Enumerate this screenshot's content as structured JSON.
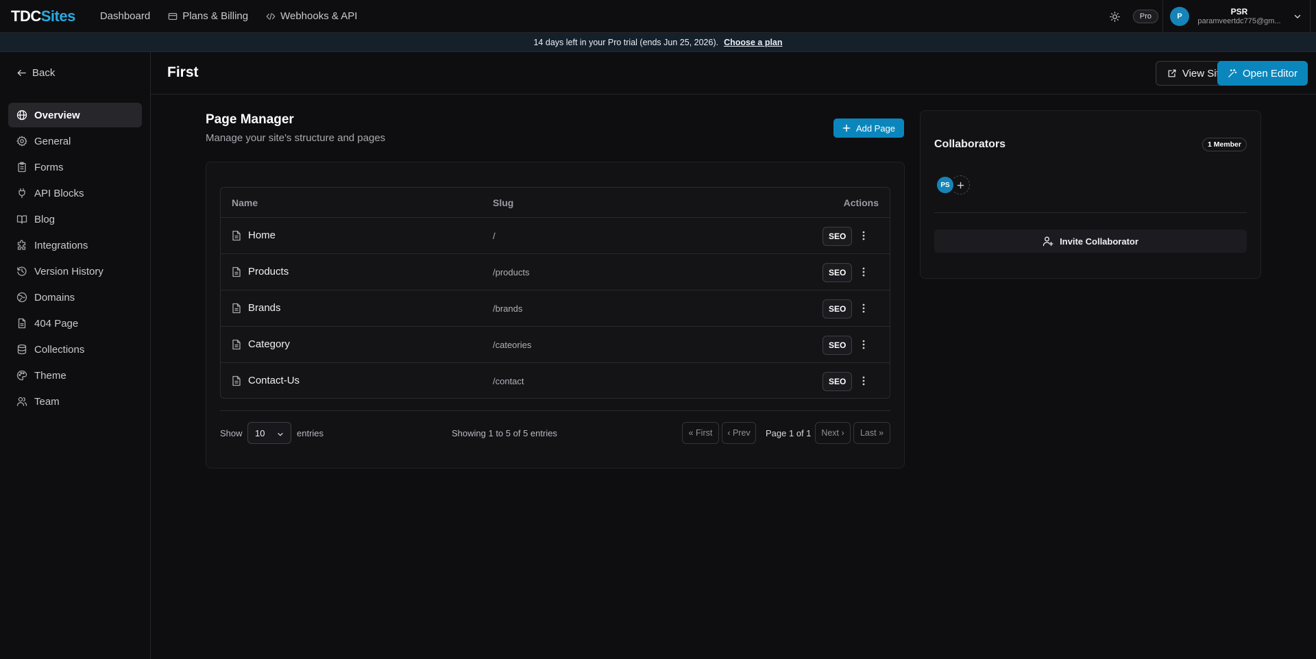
{
  "brand": {
    "part1": "TDC",
    "part2": "Sites"
  },
  "nav": {
    "dashboard": "Dashboard",
    "billing": "Plans & Billing",
    "webhooks": "Webhooks & API"
  },
  "user": {
    "plan_badge": "Pro",
    "avatar_initial": "P",
    "name": "PSR",
    "email": "paramveertdc775@gm..."
  },
  "banner": {
    "text": "14 days left in your Pro trial (ends Jun 25, 2026).",
    "cta": "Choose a plan"
  },
  "sidebar": {
    "back": "Back",
    "items": [
      {
        "label": "Overview",
        "icon": "globe-icon"
      },
      {
        "label": "General",
        "icon": "gear-icon"
      },
      {
        "label": "Forms",
        "icon": "clipboard-icon"
      },
      {
        "label": "API Blocks",
        "icon": "plug-icon"
      },
      {
        "label": "Blog",
        "icon": "book-icon"
      },
      {
        "label": "Integrations",
        "icon": "puzzle-icon"
      },
      {
        "label": "Version History",
        "icon": "history-icon"
      },
      {
        "label": "Domains",
        "icon": "globe-grid-icon"
      },
      {
        "label": "404 Page",
        "icon": "file-icon"
      },
      {
        "label": "Collections",
        "icon": "database-icon"
      },
      {
        "label": "Theme",
        "icon": "palette-icon"
      },
      {
        "label": "Team",
        "icon": "users-icon"
      }
    ]
  },
  "header": {
    "title": "First",
    "view_site": "View Site",
    "open_editor": "Open Editor"
  },
  "page_manager": {
    "title": "Page Manager",
    "subtitle": "Manage your site's structure and pages",
    "add_page": "Add Page",
    "columns": {
      "name": "Name",
      "slug": "Slug",
      "actions": "Actions"
    },
    "rows": [
      {
        "name": "Home",
        "slug": "/",
        "seo": "SEO"
      },
      {
        "name": "Products",
        "slug": "/products",
        "seo": "SEO"
      },
      {
        "name": "Brands",
        "slug": "/brands",
        "seo": "SEO"
      },
      {
        "name": "Category",
        "slug": "/cateories",
        "seo": "SEO"
      },
      {
        "name": "Contact-Us",
        "slug": "/contact",
        "seo": "SEO"
      }
    ],
    "footer": {
      "show": "Show",
      "per_page": "10",
      "entries": "entries",
      "showing": "Showing 1 to 5 of 5 entries",
      "first": "« First",
      "prev": "‹ Prev",
      "page": "Page 1 of 1",
      "next": "Next ›",
      "last": "Last »"
    }
  },
  "collaborators": {
    "title": "Collaborators",
    "member_count": "1 Member",
    "avatar": "PS",
    "invite": "Invite Collaborator"
  },
  "colors": {
    "accent": "#0b86bd",
    "brand_blue": "#29a9e0",
    "background": "#0e0e10",
    "banner": "#16202b"
  }
}
